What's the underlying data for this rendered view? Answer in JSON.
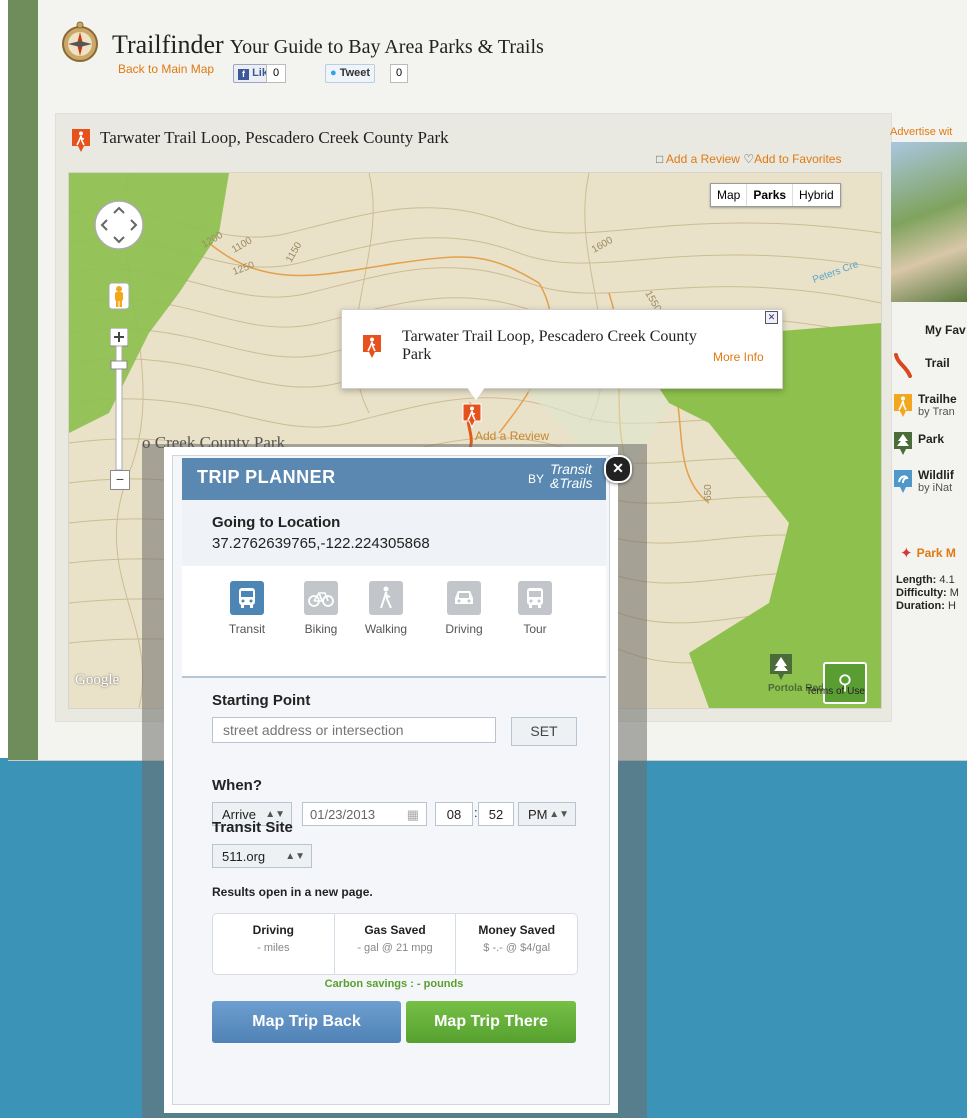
{
  "header": {
    "site_name": "Trailfinder",
    "tagline": "Your Guide to Bay Area Parks & Trails",
    "back_link": "Back to Main Map",
    "like_label": "Like",
    "like_count": "0",
    "tweet_label": "Tweet",
    "tweet_count": "0"
  },
  "park": {
    "title": "Tarwater Trail Loop, Pescadero Creek County Park",
    "add_review": "Add a Review",
    "add_favorites": "Add to Favorites"
  },
  "ad": {
    "label": "Advertise wit"
  },
  "map": {
    "types": [
      "Map",
      "Parks",
      "Hybrid"
    ],
    "active_type": "Parks",
    "google": "Google",
    "terms": "Terms of Use",
    "portola": "Portola Redwoods",
    "contour_labels": [
      "1200",
      "1100",
      "1150",
      "1250",
      "1600",
      "1550",
      "650",
      "Peters Cre"
    ],
    "info_window": {
      "title": "Tarwater Trail Loop, Pescadero Creek County Park",
      "more_info": "More Info"
    }
  },
  "overlay": {
    "title": "o Creek County Park",
    "review": "Add a Review"
  },
  "trip_planner": {
    "title": "TRIP PLANNER",
    "by": "BY",
    "brand_line1": "Transit",
    "brand_line2": "&Trails",
    "going_label": "Going to Location",
    "going_value": "37.2762639765,-122.224305868",
    "modes": [
      {
        "label": "Transit",
        "icon": "bus-icon",
        "active": true
      },
      {
        "label": "Biking",
        "icon": "bike-icon",
        "active": false
      },
      {
        "label": "Walking",
        "icon": "walking-icon",
        "active": false
      },
      {
        "label": "Driving",
        "icon": "car-icon",
        "active": false
      },
      {
        "label": "Tour",
        "icon": "tour-bus-icon",
        "active": false
      }
    ],
    "starting_label": "Starting Point",
    "starting_placeholder": "street address or intersection",
    "set_label": "SET",
    "when_label": "When?",
    "arrive_value": "Arrive",
    "date_value": "01/23/2013",
    "hour_value": "08",
    "minute_value": "52",
    "ampm_value": "PM",
    "transit_site_label": "Transit Site",
    "transit_site_value": "511.org",
    "results_note": "Results open in a new page.",
    "stats": [
      {
        "title": "Driving",
        "value": "- miles"
      },
      {
        "title": "Gas Saved",
        "value": "- gal @ 21 mpg"
      },
      {
        "title": "Money Saved",
        "value": "$ -.- @ $4/gal"
      }
    ],
    "carbon": "Carbon savings : - pounds",
    "map_back": "Map Trip Back",
    "map_there": "Map Trip There"
  },
  "sidebar": {
    "heading": "My Fav",
    "items": [
      {
        "title": "Trail",
        "sub": ""
      },
      {
        "title": "Trailhe",
        "sub": "by Tran"
      },
      {
        "title": "Park",
        "sub": ""
      },
      {
        "title": "Wildlif",
        "sub": "by iNat"
      },
      {
        "title": "Park M",
        "sub": ""
      }
    ],
    "specs": [
      {
        "label": "Length:",
        "value": "4.1"
      },
      {
        "label": "Difficulty:",
        "value": "M"
      },
      {
        "label": "Duration:",
        "value": "H"
      }
    ]
  },
  "colors": {
    "accent_orange": "#e07a10",
    "planner_blue": "#5a88b0",
    "park_green": "#8dc04c",
    "band_blue": "#3b93b8"
  }
}
